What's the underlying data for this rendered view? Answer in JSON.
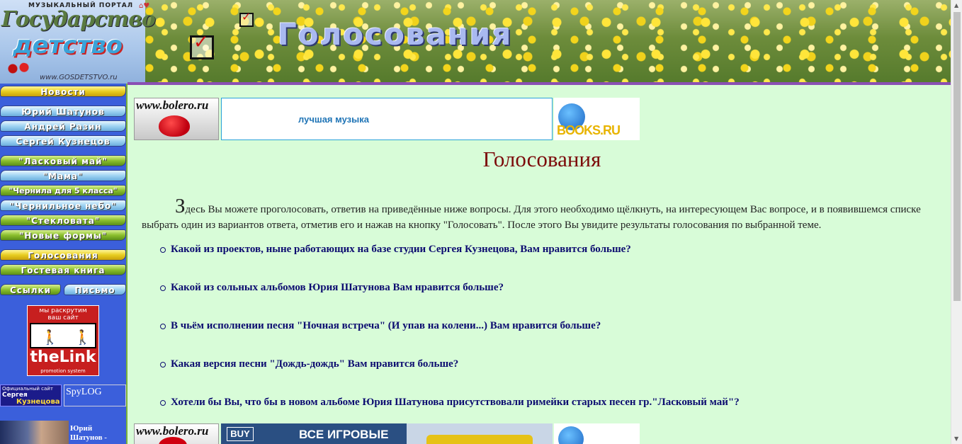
{
  "header": {
    "portal_label": "МУЗЫКАЛЬНЫЙ ПОРТАЛ",
    "logo_line1": "Государство",
    "logo_line2": "детство",
    "logo_url": "www.GOSDETSTVO.ru",
    "section_title": "Голосования"
  },
  "sidebar": {
    "items": [
      {
        "label": "Новости",
        "style": "yellow"
      },
      {
        "label": "Юрий Шатунов",
        "style": "blue"
      },
      {
        "label": "Андрей Разин",
        "style": "blue"
      },
      {
        "label": "Сергей Кузнецов",
        "style": "blue"
      },
      {
        "label": "\"Ласковый май\"",
        "style": "green"
      },
      {
        "label": "\"Мама\"",
        "style": "blue"
      },
      {
        "label": "\"Чернила для 5 класса\"",
        "style": "green"
      },
      {
        "label": "\"Чернильное небо\"",
        "style": "blue"
      },
      {
        "label": "\"Стекловата\"",
        "style": "green"
      },
      {
        "label": "\"Новые формы\"",
        "style": "green"
      },
      {
        "label": "Голосования",
        "style": "yellow"
      },
      {
        "label": "Гостевая книга",
        "style": "green"
      },
      {
        "label": "Ссылки",
        "style": "green"
      },
      {
        "label": "Письмо",
        "style": "blue"
      }
    ],
    "thelink": {
      "top_line1": "мы раскрутим",
      "top_line2": "ваш сайт",
      "brand": "theLink",
      "tagline": "promotion system"
    },
    "kuznetsov_badge": {
      "line1": "Официальный сайт",
      "line2": "Сергея",
      "line3": "Кузнецова"
    },
    "spylog_alt": "SpyLOG",
    "shatunov_caption_line1": "Юрий",
    "shatunov_caption_line2": "Шатунов -"
  },
  "banners": {
    "bolero_text": "www.bolero.ru",
    "middle_text": "лучшая музыка",
    "books_text": "BOOKS.RU",
    "game_buy": "BUY",
    "game_text": "ВСЕ ИГРОВЫЕ"
  },
  "main": {
    "title": "Голосования",
    "intro_initial": "З",
    "intro_text": "десь Вы можете проголосовать, ответив на приведённые ниже вопросы. Для этого необходимо щёлкнуть, на интересующем Вас вопросе, и в появившемся списке выбрать один из вариантов ответа, отметив его и нажав на кнопку \"Голосовать\". После этого Вы увидите результаты голосования по выбранной теме.",
    "questions": [
      "Какой из проектов, ныне работающих на базе студии Сергея Кузнецова, Вам нравится больше?",
      "Какой из сольных альбомов Юрия Шатунова Вам нравится больше?",
      "В чьём исполнении песня \"Ночная встреча\" (И упав на колени...) Вам нравится больше?",
      "Какая версия песни \"Дождь-дождь\" Вам нравится больше?",
      "Хотели бы Вы, что бы в новом альбоме Юрия Шатунова присутствовали римейки старых песен гр.\"Ласковый май\"?"
    ]
  },
  "colors": {
    "sidebar_bg": "#3b5fdb",
    "page_bg": "#d8fcd8",
    "title": "#7c0a0a",
    "question": "#0c0c70"
  }
}
